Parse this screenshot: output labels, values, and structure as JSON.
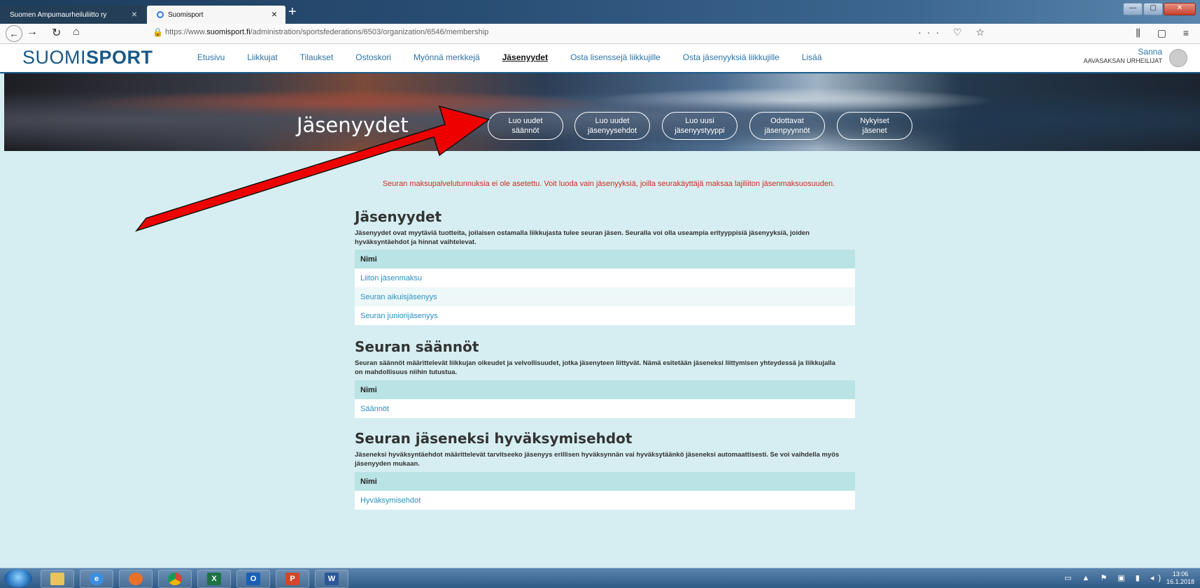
{
  "browser": {
    "tabs": [
      {
        "title": "Suomen Ampumaurheiluliitto ry",
        "active": false
      },
      {
        "title": "Suomisport",
        "active": true
      }
    ],
    "close_glyph": "×",
    "new_tab_glyph": "+",
    "url_prefix": "https://www.",
    "url_domain": "suomisport.fi",
    "url_path": "/administration/sportsfederations/6503/organization/6546/membership",
    "url_icons": "··· ♡ ☆",
    "side_icons": "⫼ ▢ ≡"
  },
  "site": {
    "logo_light": "SUOMI",
    "logo_bold": "SPORT",
    "nav": [
      {
        "label": "Etusivu",
        "active": false
      },
      {
        "label": "Liikkujat",
        "active": false
      },
      {
        "label": "Tilaukset",
        "active": false
      },
      {
        "label": "Ostoskori",
        "active": false
      },
      {
        "label": "Myönnä merkkejä",
        "active": false
      },
      {
        "label": "Jäsenyydet",
        "active": true
      },
      {
        "label": "Osta lisenssejä liikkujille",
        "active": false
      },
      {
        "label": "Osta jäsenyyksiä liikkujille",
        "active": false
      },
      {
        "label": "Lisää",
        "active": false
      }
    ],
    "user_name": "Sanna",
    "user_org": "AAVASAKSAN URHEILIJAT"
  },
  "hero": {
    "title": "Jäsenyydet",
    "buttons": [
      {
        "label": "Luo uudet\nsäännöt"
      },
      {
        "label": "Luo uudet\njäsenyysehdot"
      },
      {
        "label": "Luo uusi\njäsenyystyyppi"
      },
      {
        "label": "Odottavat\njäsenpyynnöt"
      },
      {
        "label": "Nykyiset\njäsenet"
      }
    ]
  },
  "notice": "Seuran maksupalvelutunnuksia ei ole asetettu. Voit luoda vain jäsenyyksiä, joilla seurakäyttäjä maksaa lajiliiton jäsenmaksuosuuden.",
  "sections": [
    {
      "title": "Jäsenyydet",
      "description": "Jäsenyydet ovat myytäviä tuotteita, joilaisen ostamalla liikkujasta tulee seuran jäsen. Seuralla voi olla useampia erityyppisiä jäsenyyksiä, joiden hyväksyntäehdot ja hinnat vaihtelevat.",
      "column": "Nimi",
      "rows": [
        "Liiton jäsenmaksu",
        "Seuran aikuisjäsenyys",
        "Seuran juniorijäsenyys"
      ]
    },
    {
      "title": "Seuran säännöt",
      "description": "Seuran säännöt määrittelevät liikkujan oikeudet ja velvollisuudet, jotka jäsenyteen liittyvät. Nämä esitetään jäseneksi liittymisen yhteydessä ja liikkujalla on mahdollisuus niihin tutustua.",
      "column": "Nimi",
      "rows": [
        "Säännöt"
      ]
    },
    {
      "title": "Seuran jäseneksi hyväksymisehdot",
      "description": "Jäseneksi hyväksyntäehdot määrittelevät tarvitseeko jäsenyys erillisen hyväksynnän vai hyväksytäänkö jäseneksi automaattisesti. Se voi vaihdella myös jäsenyyden mukaan.",
      "column": "Nimi",
      "rows": [
        "Hyväksymisehdot"
      ]
    }
  ],
  "annotation": {
    "arrow_color": "#ee0000"
  },
  "taskbar": {
    "apps": [
      {
        "icon": "explorer-folder-icon",
        "glyph": "",
        "color": "#e8c45a"
      },
      {
        "icon": "internet-explorer-icon",
        "glyph": "e",
        "color": "#3a8fe0"
      },
      {
        "icon": "firefox-icon",
        "glyph": "",
        "color": "#e8702a"
      },
      {
        "icon": "chrome-icon",
        "glyph": "",
        "color": "#3fa34d"
      },
      {
        "icon": "excel-icon",
        "glyph": "X",
        "color": "#1f7244"
      },
      {
        "icon": "outlook-icon",
        "glyph": "O",
        "color": "#1a5fb4"
      },
      {
        "icon": "powerpoint-icon",
        "glyph": "P",
        "color": "#d24726"
      },
      {
        "icon": "word-icon",
        "glyph": "W",
        "color": "#2b5797"
      }
    ],
    "tray": "▭ ▲ ⚑ ▣ ▮ ◂)",
    "time": "13:06",
    "date": "16.1.2018"
  }
}
